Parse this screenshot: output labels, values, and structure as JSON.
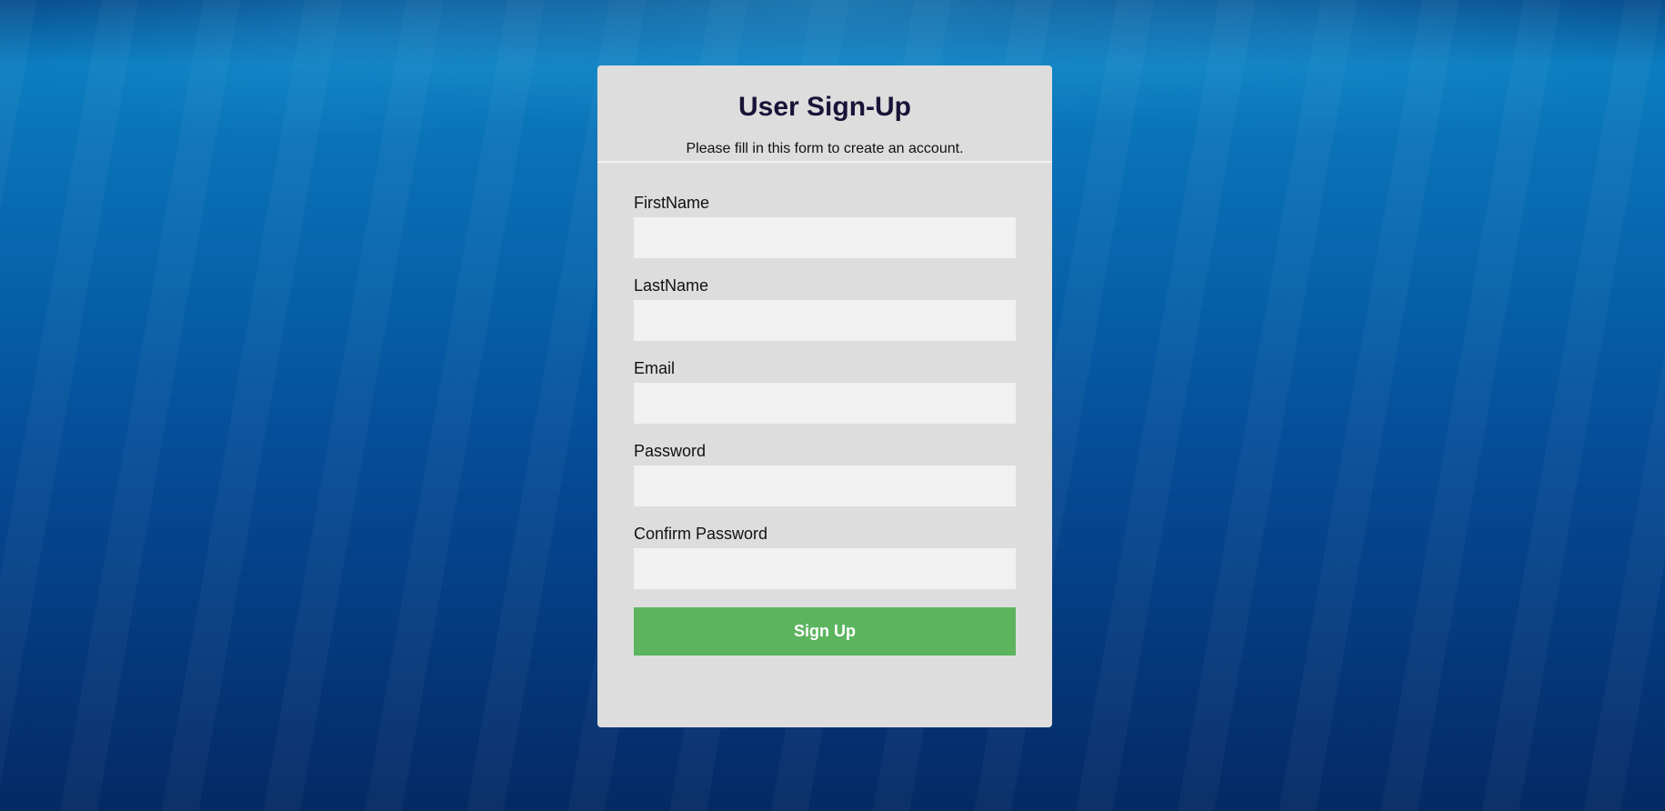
{
  "page": {
    "background_color": "#05509b"
  },
  "card": {
    "title": "User Sign-Up",
    "subtitle": "Please fill in this form to create an account.",
    "background_color": "#dddddd"
  },
  "form": {
    "fields": [
      {
        "label": "FirstName",
        "value": "",
        "placeholder": ""
      },
      {
        "label": "LastName",
        "value": "",
        "placeholder": ""
      },
      {
        "label": "Email",
        "value": "",
        "placeholder": ""
      },
      {
        "label": "Password",
        "value": "",
        "placeholder": ""
      },
      {
        "label": "Confirm Password",
        "value": "",
        "placeholder": ""
      }
    ],
    "submit_label": "Sign Up",
    "submit_color": "#5cb45f"
  }
}
